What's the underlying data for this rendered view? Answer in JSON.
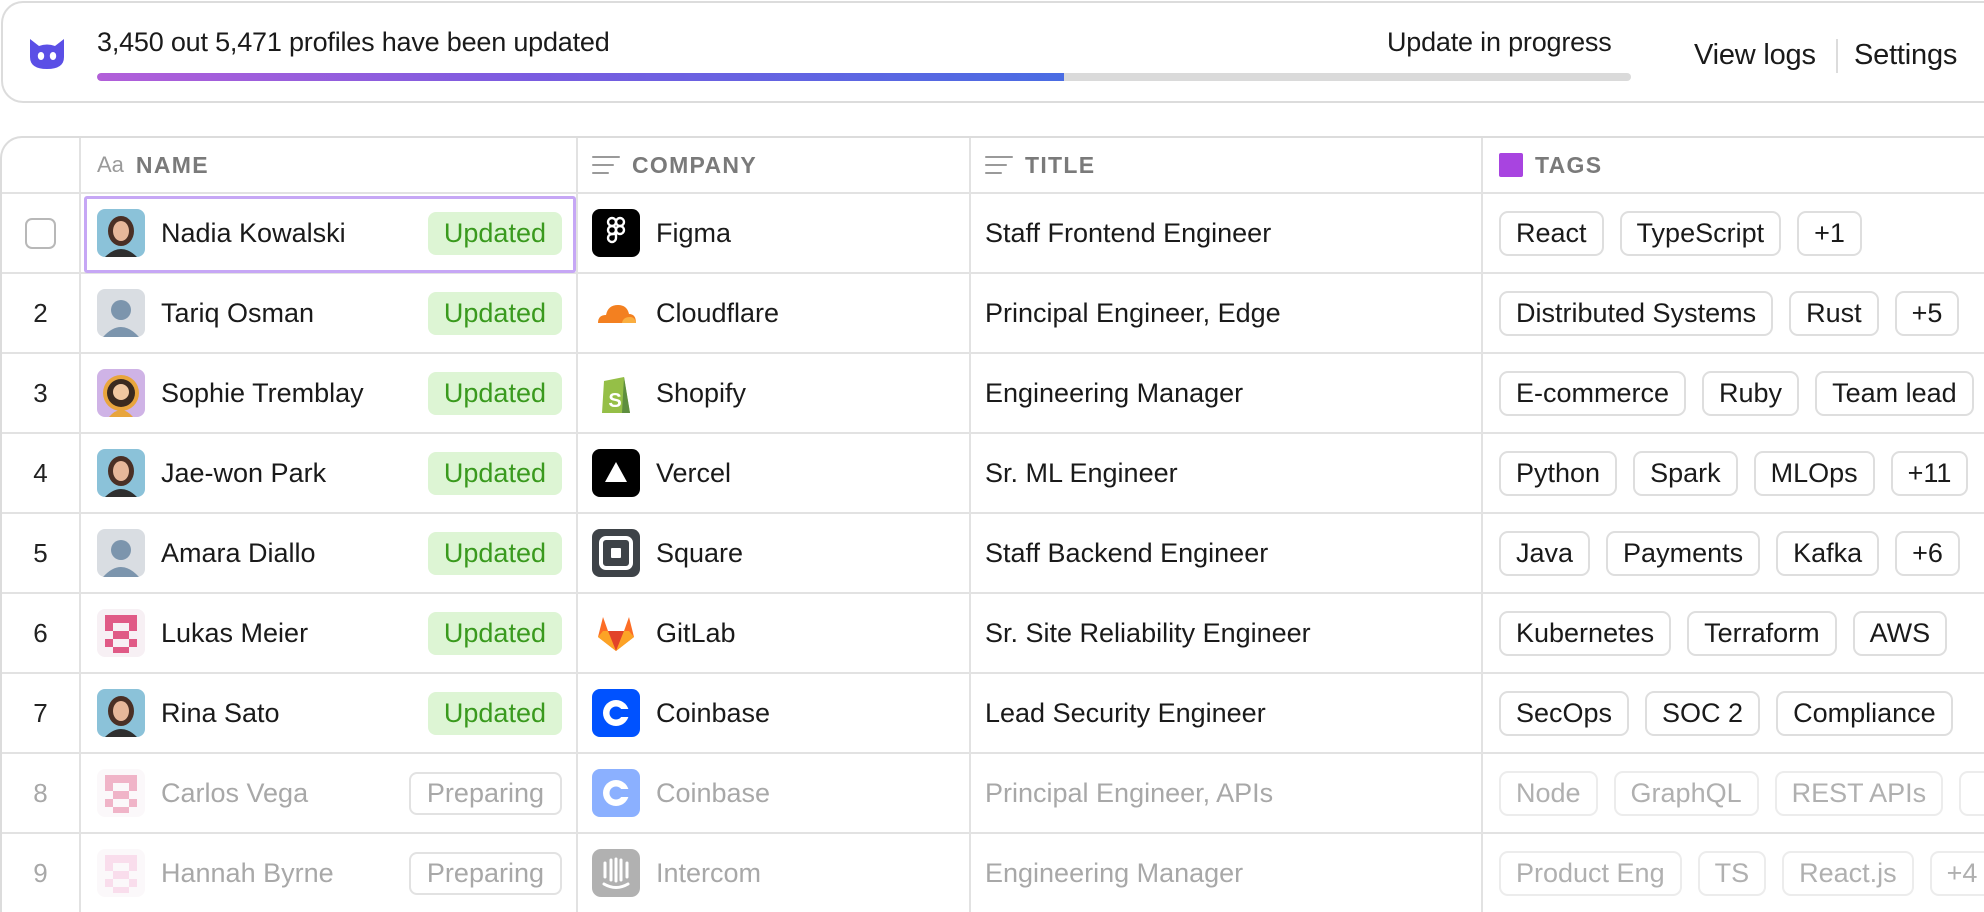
{
  "progress": {
    "message": "3,450 out 5,471 profiles have been updated",
    "status": "Update in progress",
    "updated": 3450,
    "total": 5471,
    "gradient": [
      "#b25fd9",
      "#4a6ce3"
    ]
  },
  "topbar": {
    "view_logs": "View logs",
    "settings": "Settings"
  },
  "columns": {
    "name": "NAME",
    "name_icon": "Aa",
    "company": "COMPANY",
    "title": "TITLE",
    "tags": "TAGS"
  },
  "colors": {
    "tags_square": "#a844e0",
    "updated_bg": "#ddf5d4",
    "updated_text": "#3a9a1e",
    "selection": "#c6a7f5"
  },
  "rows": [
    {
      "num": "",
      "checkbox": true,
      "name": "Nadia Kowalski",
      "status": "Updated",
      "avatar": "photo-woman",
      "company": "Figma",
      "logo": "figma-logo",
      "title": "Staff Frontend Engineer",
      "tags": [
        "React",
        "TypeScript",
        "+1"
      ]
    },
    {
      "num": "2",
      "name": "Tariq Osman",
      "status": "Updated",
      "avatar": "default-person",
      "company": "Cloudflare",
      "logo": "cloudflare-logo",
      "title": "Principal Engineer, Edge",
      "tags": [
        "Distributed Systems",
        "Rust",
        "+5"
      ]
    },
    {
      "num": "3",
      "name": "Sophie Tremblay",
      "status": "Updated",
      "avatar": "illustrated-woman",
      "company": "Shopify",
      "logo": "shopify-logo",
      "title": "Engineering Manager",
      "tags": [
        "E-commerce",
        "Ruby",
        "Team lead"
      ]
    },
    {
      "num": "4",
      "name": "Jae-won Park",
      "status": "Updated",
      "avatar": "photo-woman",
      "company": "Vercel",
      "logo": "vercel-logo",
      "title": "Sr. ML Engineer",
      "tags": [
        "Python",
        "Spark",
        "MLOps",
        "+11"
      ]
    },
    {
      "num": "5",
      "name": "Amara Diallo",
      "status": "Updated",
      "avatar": "default-person",
      "company": "Square",
      "logo": "square-logo",
      "title": "Staff Backend Engineer",
      "tags": [
        "Java",
        "Payments",
        "Kafka",
        "+6"
      ]
    },
    {
      "num": "6",
      "name": "Lukas Meier",
      "status": "Updated",
      "avatar": "pixel-identicon",
      "company": "GitLab",
      "logo": "gitlab-logo",
      "title": "Sr. Site Reliability Engineer",
      "tags": [
        "Kubernetes",
        "Terraform",
        "AWS"
      ]
    },
    {
      "num": "7",
      "name": "Rina Sato",
      "status": "Updated",
      "avatar": "photo-woman",
      "company": "Coinbase",
      "logo": "coinbase-logo",
      "title": "Lead Security Engineer",
      "tags": [
        "SecOps",
        "SOC 2",
        "Compliance"
      ]
    },
    {
      "num": "8",
      "name": "Carlos Vega",
      "status": "Preparing",
      "avatar": "pixel-identicon",
      "company": "Coinbase",
      "logo": "coinbase-logo",
      "title": "Principal Engineer, APIs",
      "tags": [
        "Node",
        "GraphQL",
        "REST APIs",
        ""
      ]
    },
    {
      "num": "9",
      "name": "Hannah Byrne",
      "status": "Preparing",
      "avatar": "pixel-identicon",
      "company": "Intercom",
      "logo": "intercom-logo",
      "title": "Engineering Manager",
      "tags": [
        "Product Eng",
        "TS",
        "React.js",
        "+4"
      ]
    }
  ]
}
